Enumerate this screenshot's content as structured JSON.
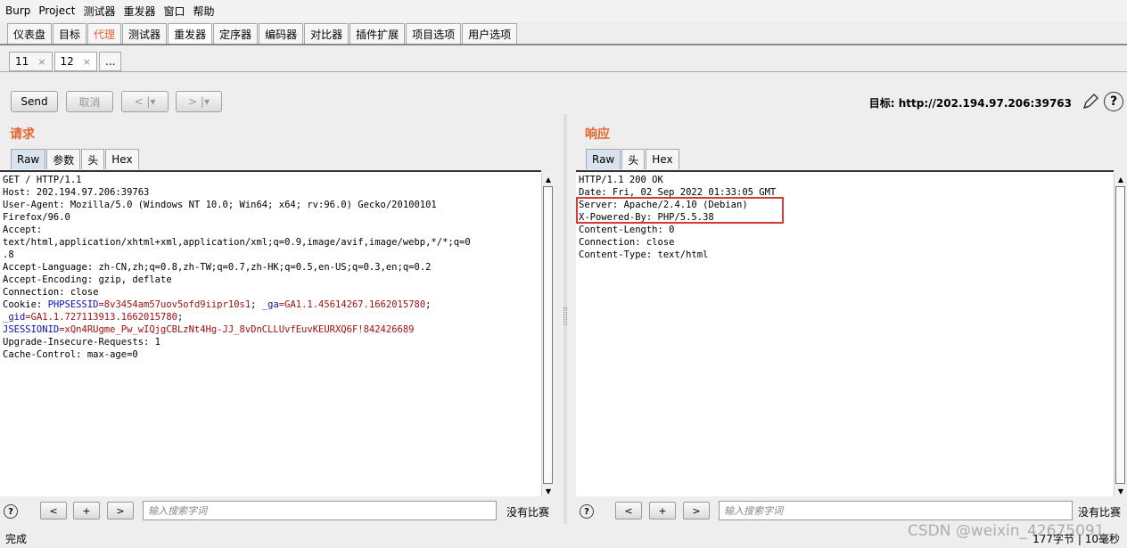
{
  "menu": [
    "Burp",
    "Project",
    "测试器",
    "重发器",
    "窗口",
    "帮助"
  ],
  "main_tabs": [
    "仪表盘",
    "目标",
    "代理",
    "测试器",
    "重发器",
    "定序器",
    "编码器",
    "对比器",
    "插件扩展",
    "项目选项",
    "用户选项"
  ],
  "sub_tabs": [
    {
      "label": "11",
      "close": "×"
    },
    {
      "label": "12",
      "close": "×"
    },
    {
      "label": "..."
    }
  ],
  "toolbar": {
    "send": "Send",
    "cancel": "取消",
    "back": "< |▾",
    "forward": "> |▾",
    "target": "目标: http://202.194.97.206:39763",
    "help": "?"
  },
  "request": {
    "title": "请求",
    "tabs": [
      "Raw",
      "参数",
      "头",
      "Hex"
    ],
    "lines": [
      "GET / HTTP/1.1",
      "Host: 202.194.97.206:39763",
      "User-Agent: Mozilla/5.0 (Windows NT 10.0; Win64; x64; rv:96.0) Gecko/20100101",
      "Firefox/96.0",
      "Accept:",
      "text/html,application/xhtml+xml,application/xml;q=0.9,image/avif,image/webp,*/*;q=0",
      ".8",
      "Accept-Language: zh-CN,zh;q=0.8,zh-TW;q=0.7,zh-HK;q=0.5,en-US;q=0.3,en;q=0.2",
      "Accept-Encoding: gzip, deflate",
      "Connection: close"
    ],
    "cookie": {
      "prefix": "Cookie: ",
      "k1": "PHPSESSID",
      "v1": "=8v3454am57uov5ofd9iipr10s1",
      "sep1": "; ",
      "k2": "_ga",
      "v2": "=GA1.1.45614267.1662015780",
      "sep2": ";",
      "k3": "_gid",
      "v3": "=GA1.1.727113913.1662015780",
      "sep3": ";",
      "k4": "JSESSIONID",
      "v4": "=xQn4RUgme_Pw_wIQjgCBLzNt4Hg-JJ_8vDnCLLUvfEuvKEURXQ6F!842426689"
    },
    "tail": [
      "Upgrade-Insecure-Requests: 1",
      "Cache-Control: max-age=0"
    ],
    "search_placeholder": "输入搜索字词",
    "no_match": "没有比赛"
  },
  "response": {
    "title": "响应",
    "tabs": [
      "Raw",
      "头",
      "Hex"
    ],
    "lines": [
      "HTTP/1.1 200 OK",
      "Date: Fri, 02 Sep 2022 01:33:05 GMT",
      "Server: Apache/2.4.10 (Debian)",
      "X-Powered-By: PHP/5.5.38",
      "Content-Length: 0",
      "Connection: close",
      "Content-Type: text/html"
    ],
    "search_placeholder": "输入搜索字词",
    "no_match": "没有比赛"
  },
  "search_buttons": [
    "<",
    "+",
    ">"
  ],
  "status": {
    "left": "完成",
    "right": "177字节 | 10毫秒"
  },
  "watermark": "CSDN @weixin_42675091"
}
